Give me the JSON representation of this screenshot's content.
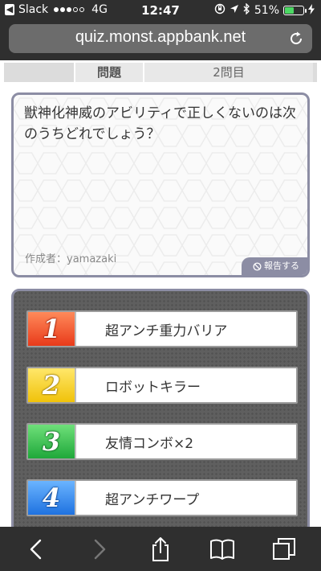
{
  "status_bar": {
    "app_back_label": "Slack",
    "carrier_signal": "●●●○○",
    "network": "4G",
    "time": "12:47",
    "battery_percent": "51%",
    "battery_level": 0.51,
    "icons": [
      "orientation-lock-icon",
      "location-icon",
      "bluetooth-icon",
      "battery-icon"
    ]
  },
  "browser": {
    "url": "quiz.monst.appbank.net",
    "toolbar": [
      "back-icon",
      "forward-icon",
      "share-icon",
      "bookmarks-icon",
      "tabs-icon"
    ]
  },
  "quiz": {
    "header": {
      "label": "問題",
      "number": "2問目"
    },
    "question": "獣神化神威のアビリティで正しくないのは次のうちどれでしょう？",
    "author": "作成者：yamazaki",
    "report_label": "報告する",
    "answers": [
      {
        "num": "1",
        "label": "超アンチ重力バリア"
      },
      {
        "num": "2",
        "label": "ロボットキラー"
      },
      {
        "num": "3",
        "label": "友情コンボ×2"
      },
      {
        "num": "4",
        "label": "超アンチワープ"
      }
    ]
  },
  "colors": {
    "chrome": "#2f2f2f",
    "panel_border": "#8c8da4",
    "answer_1": "#e83a1a",
    "answer_2": "#f0c20a",
    "answer_3": "#1fa83a",
    "answer_4": "#1f72e0"
  }
}
